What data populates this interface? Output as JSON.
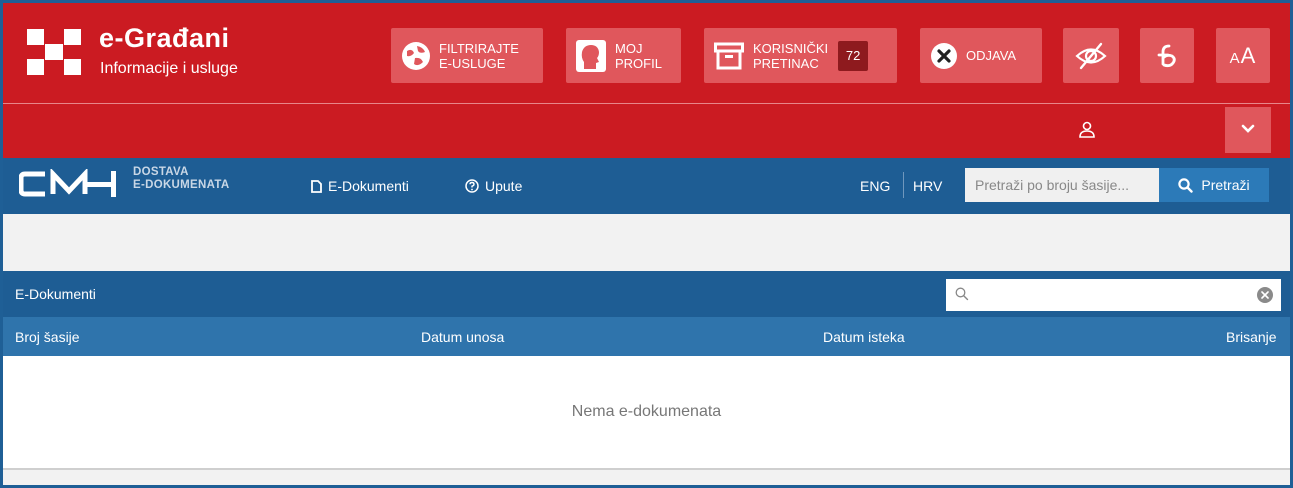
{
  "header": {
    "brand_title": "e-Građani",
    "brand_subtitle": "Informacije i usluge",
    "buttons": {
      "filter": [
        "FILTRIRAJTE",
        "E-USLUGE"
      ],
      "profile": [
        "MOJ",
        "PROFIL"
      ],
      "mailbox": [
        "KORISNIČKI",
        "PRETINAC"
      ],
      "mailbox_count": "72",
      "logout": "ODJAVA",
      "font_size": "AA"
    },
    "colors": {
      "header_red": "#cb1b22",
      "button_red": "#e0575c",
      "badge_dark": "#8e1a1e"
    }
  },
  "app_nav": {
    "logo_line1": "DOSTAVA",
    "logo_line2": "E-DOKUMENATA",
    "links": {
      "documents": "E-Dokumenti",
      "help": "Upute"
    },
    "languages": {
      "eng": "ENG",
      "hrv": "HRV"
    },
    "search_placeholder": "Pretraži po broju šasije...",
    "search_button": "Pretraži",
    "colors": {
      "nav_blue": "#1e5d94",
      "button_blue": "#2c7ab8"
    }
  },
  "grid": {
    "title": "E-Dokumenti",
    "filter_value": "",
    "columns": [
      "Broj šasije",
      "Datum unosa",
      "Datum isteka",
      "Brisanje"
    ],
    "rows": [],
    "empty_message": "Nema e-dokumenata"
  }
}
